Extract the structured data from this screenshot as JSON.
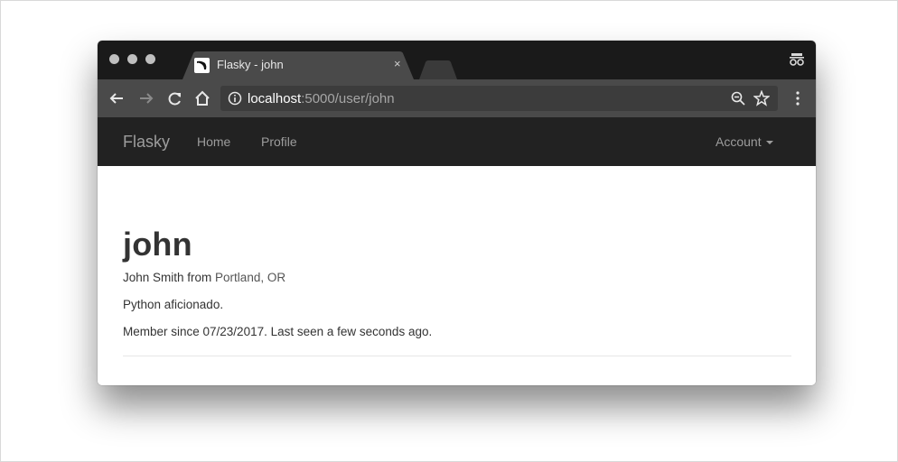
{
  "browser": {
    "tab_title": "Flasky - john",
    "tab_close": "×",
    "url_host": "localhost",
    "url_path": ":5000/user/john"
  },
  "navbar": {
    "brand": "Flasky",
    "links": [
      "Home",
      "Profile"
    ],
    "account_label": "Account"
  },
  "profile": {
    "username": "john",
    "name_prefix": "John Smith from ",
    "location": "Portland, OR",
    "about": "Python aficionado.",
    "member_line": "Member since 07/23/2017. Last seen a few seconds ago."
  },
  "colors": {
    "navbar_bg": "#222222",
    "navbar_text": "#9d9d9d",
    "tabstrip_bg": "#1a1a1a",
    "toolbar_bg": "#4a4a4a"
  }
}
